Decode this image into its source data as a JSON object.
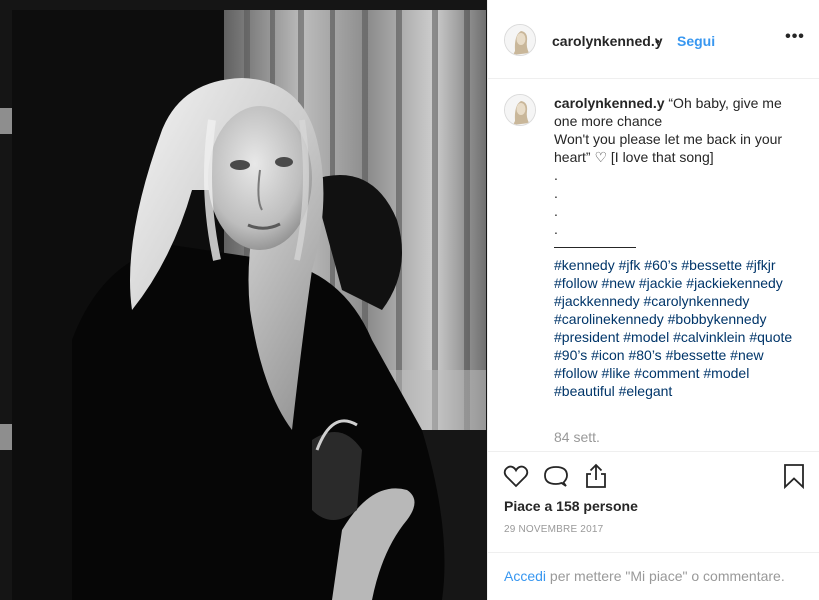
{
  "header": {
    "username": "carolynkenned.y",
    "separator": "•",
    "follow_label": "Segui",
    "more_label": "•••"
  },
  "caption": {
    "username": "carolynkenned.y",
    "lines": [
      "“Oh baby, give me one more chance",
      "Won't you please let me back in your heart” ♡ [I love that song]",
      ".",
      ".",
      ".",
      "."
    ],
    "hashtags": "#kennedy #jfk #60’s #bessette #jfkjr #follow #new #jackie #jackiekennedy #jackkennedy #carolynkennedy #carolinekennedy #bobbykennedy #president #model #calvinklein #quote #90’s #icon #80’s #bessette #new #follow #like #comment #model #beautiful #elegant",
    "age": "84 sett."
  },
  "actions": {
    "icons": [
      "heart-icon",
      "comment-icon",
      "share-icon",
      "bookmark-icon"
    ],
    "likes_text": "Piace a 158 persone",
    "date_text": "29 NOVEMBRE 2017"
  },
  "footer": {
    "login_link": "Accedi",
    "login_rest": " per mettere \"Mi piace\" o commentare."
  },
  "colors": {
    "accent": "#3897f0",
    "hashtag": "#003569",
    "muted": "#999999",
    "text": "#262626",
    "border": "#efefef"
  }
}
